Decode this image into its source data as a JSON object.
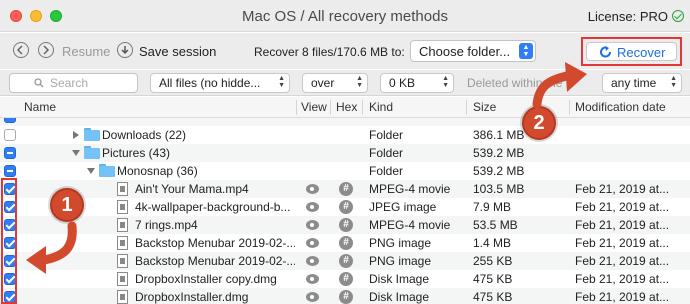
{
  "window": {
    "title": "Mac OS / All recovery methods",
    "license": "License: PRO"
  },
  "toolbar": {
    "resume_label": "Resume",
    "save_session_label": "Save session",
    "recover_info": "Recover 8 files/170.6 MB to:",
    "destination_value": "Choose folder...",
    "recover_label": "Recover"
  },
  "filters": {
    "search_placeholder": "Search",
    "files_filter": "All files (no hidde...",
    "size_op": "over",
    "size_value": "0 KB",
    "deleted_label": "Deleted within the",
    "time_value": "any time"
  },
  "columns": {
    "name": "Name",
    "view": "View",
    "hex": "Hex",
    "kind": "Kind",
    "size": "Size",
    "modified": "Modification date"
  },
  "rows": [
    {
      "name": "Downloads (22)",
      "kind": "Folder",
      "size": "386.1 MB",
      "date": ""
    },
    {
      "name": "Pictures (43)",
      "kind": "Folder",
      "size": "539.2 MB",
      "date": ""
    },
    {
      "name": "Monosnap (36)",
      "kind": "Folder",
      "size": "539.2 MB",
      "date": ""
    },
    {
      "name": "Ain't Your Mama.mp4",
      "kind": "MPEG-4 movie",
      "size": "103.5 MB",
      "date": "Feb 21, 2019 at..."
    },
    {
      "name": "4k-wallpaper-background-b...",
      "kind": "JPEG image",
      "size": "7.9 MB",
      "date": "Feb 21, 2019 at..."
    },
    {
      "name": "7 rings.mp4",
      "kind": "MPEG-4 movie",
      "size": "53.5 MB",
      "date": "Feb 21, 2019 at..."
    },
    {
      "name": "Backstop Menubar 2019-02-...",
      "kind": "PNG image",
      "size": "1.4 MB",
      "date": "Feb 21, 2019 at..."
    },
    {
      "name": "Backstop Menubar 2019-02-...",
      "kind": "PNG image",
      "size": "255 KB",
      "date": "Feb 21, 2019 at..."
    },
    {
      "name": "DropboxInstaller copy.dmg",
      "kind": "Disk Image",
      "size": "475 KB",
      "date": "Feb 21, 2019 at..."
    },
    {
      "name": "DropboxInstaller.dmg",
      "kind": "Disk Image",
      "size": "475 KB",
      "date": "Feb 21, 2019 at..."
    }
  ],
  "annotations": {
    "badge_1": "1",
    "badge_2": "2",
    "arrow_color": "#d24a2e",
    "highlight_color": "#e53636"
  },
  "colors": {
    "accent": "#2f7ef5",
    "recover_text": "#1b6fe0"
  }
}
